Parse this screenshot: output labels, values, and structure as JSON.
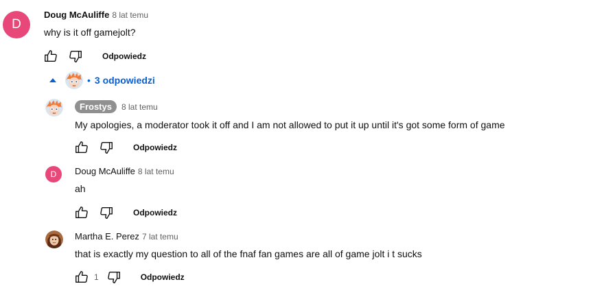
{
  "colors": {
    "avatar_pink": "#e8477a",
    "link_blue": "#065fd4",
    "owner_pill": "#909090"
  },
  "comment": {
    "author": "Doug McAuliffe",
    "avatar_letter": "D",
    "time": "8 lat temu",
    "text": "why is it off gamejolt?",
    "reply_label": "Odpowiedz"
  },
  "replies_toggle": {
    "label": "3 odpowiedzi",
    "icon": "caret-up-icon"
  },
  "replies": [
    {
      "author": "Frostys",
      "owner_badge": true,
      "time": "8 lat temu",
      "text": "My apologies, a moderator took it off and I am not allowed to put it up until it's got some form of game",
      "reply_label": "Odpowiedz"
    },
    {
      "author": "Doug McAuliffe",
      "avatar_letter": "D",
      "time": "8 lat temu",
      "text": "ah",
      "reply_label": "Odpowiedz"
    },
    {
      "author": "Martha E. Perez",
      "time": "7 lat temu",
      "text": "that is exactly my question to all of the fnaf fan games are all of game jolt i t sucks",
      "likes": "1",
      "reply_label": "Odpowiedz"
    }
  ]
}
